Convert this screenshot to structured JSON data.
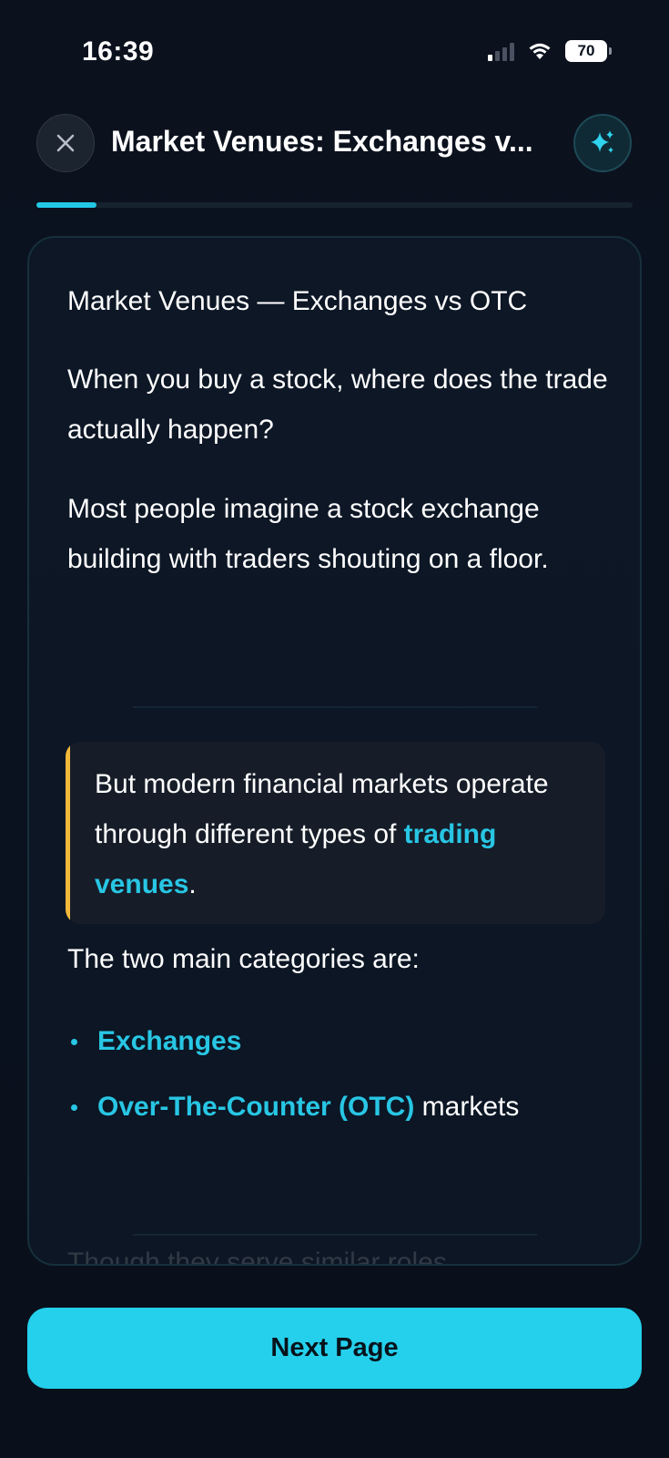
{
  "status_bar": {
    "time": "16:39",
    "battery": "70"
  },
  "header": {
    "title": "Market Venues: Exchanges v...",
    "close_icon": "close-icon",
    "ai_icon": "sparkles-icon"
  },
  "progress": {
    "fraction": 0.1
  },
  "content": {
    "heading": "Market Venues — Exchanges vs OTC",
    "paragraph_1": "When you buy a stock, where does the trade actually happen?",
    "paragraph_2": "Most people imagine a stock exchange building with traders shouting on a floor.",
    "callout": {
      "text_before": "But modern financial markets operate through different types of ",
      "highlight": "trading venues",
      "text_after": "."
    },
    "categories_intro": "The two main categories are:",
    "bullets": [
      {
        "highlight": "Exchanges",
        "suffix": ""
      },
      {
        "highlight": "Over-The-Counter (OTC)",
        "suffix": " markets"
      }
    ],
    "faded_next_line": "Though they serve similar roles,"
  },
  "footer": {
    "next_label": "Next Page"
  },
  "colors": {
    "accent": "#28c6e4",
    "button": "#24d0ec",
    "callout_bar": "#f2b83a",
    "background": "#0a111d"
  }
}
